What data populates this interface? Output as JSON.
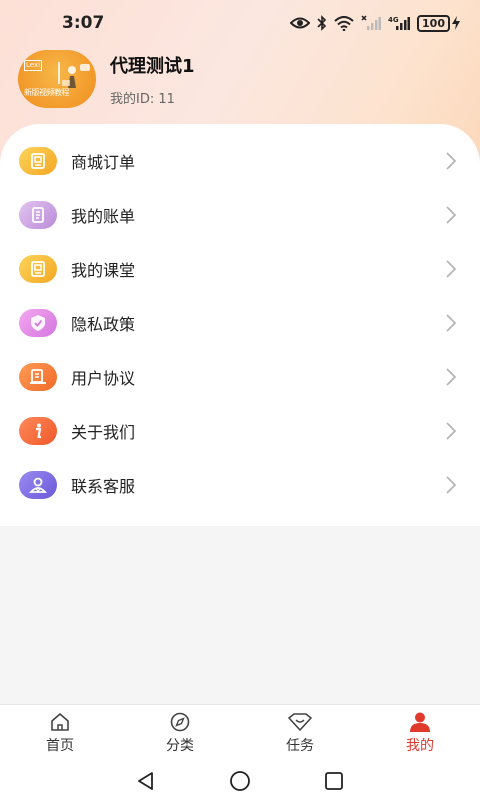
{
  "status": {
    "time": "3:07",
    "battery": "100"
  },
  "profile": {
    "avatar_caption": "新版视频教程",
    "avatar_tag": "Lexi",
    "name": "代理测试1",
    "id_label": "我的ID:",
    "id_value": "11"
  },
  "menu": [
    {
      "label": "商城订单",
      "icon": "order-icon",
      "color_from": "#fbd55a",
      "color_to": "#f5a623"
    },
    {
      "label": "我的账单",
      "icon": "bill-icon",
      "color_from": "#e3c4f0",
      "color_to": "#b88bd8"
    },
    {
      "label": "我的课堂",
      "icon": "classroom-icon",
      "color_from": "#fbd55a",
      "color_to": "#f5a623"
    },
    {
      "label": "隐私政策",
      "icon": "shield-icon",
      "color_from": "#f3a8ef",
      "color_to": "#d475e0"
    },
    {
      "label": "用户协议",
      "icon": "agreement-icon",
      "color_from": "#ff9c55",
      "color_to": "#f06a28"
    },
    {
      "label": "关于我们",
      "icon": "info-icon",
      "color_from": "#ff8a5a",
      "color_to": "#f0572a"
    },
    {
      "label": "联系客服",
      "icon": "customer-service-icon",
      "color_from": "#9a8cf0",
      "color_to": "#6a57d8"
    }
  ],
  "tabs": [
    {
      "label": "首页",
      "icon": "home-icon",
      "active": false
    },
    {
      "label": "分类",
      "icon": "compass-icon",
      "active": false
    },
    {
      "label": "任务",
      "icon": "task-icon",
      "active": false
    },
    {
      "label": "我的",
      "icon": "user-icon",
      "active": true
    }
  ],
  "colors": {
    "accent": "#e03a2c",
    "chevron": "#b5b5b5"
  }
}
